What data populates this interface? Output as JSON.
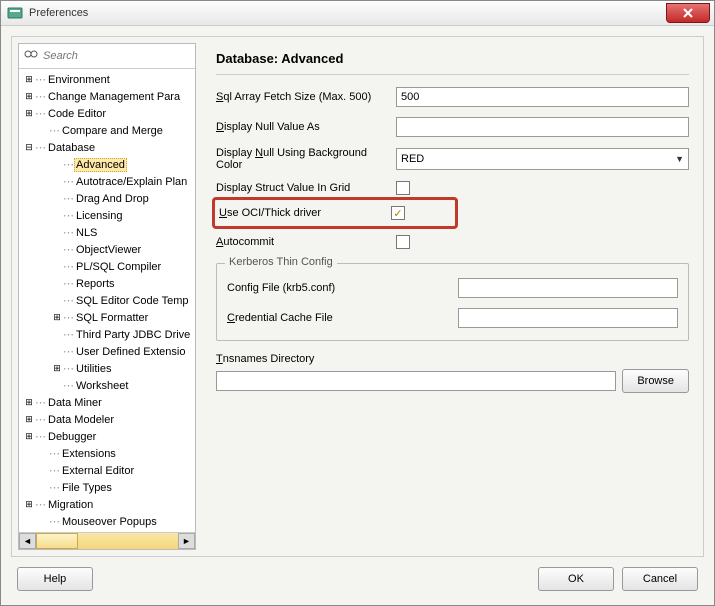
{
  "window": {
    "title": "Preferences"
  },
  "search": {
    "placeholder": "Search"
  },
  "tree": {
    "items": [
      {
        "label": "Environment",
        "expand": "plus",
        "indent": 0
      },
      {
        "label": "Change Management Para",
        "expand": "plus",
        "indent": 0
      },
      {
        "label": "Code Editor",
        "expand": "plus",
        "indent": 0
      },
      {
        "label": "Compare and Merge",
        "expand": "blank",
        "indent": 1
      },
      {
        "label": "Database",
        "expand": "minus",
        "indent": 0
      },
      {
        "label": "Advanced",
        "expand": "blank",
        "indent": 2,
        "selected": true
      },
      {
        "label": "Autotrace/Explain Plan",
        "expand": "blank",
        "indent": 2
      },
      {
        "label": "Drag And Drop",
        "expand": "blank",
        "indent": 2
      },
      {
        "label": "Licensing",
        "expand": "blank",
        "indent": 2
      },
      {
        "label": "NLS",
        "expand": "blank",
        "indent": 2
      },
      {
        "label": "ObjectViewer",
        "expand": "blank",
        "indent": 2
      },
      {
        "label": "PL/SQL Compiler",
        "expand": "blank",
        "indent": 2
      },
      {
        "label": "Reports",
        "expand": "blank",
        "indent": 2
      },
      {
        "label": "SQL Editor Code Temp",
        "expand": "blank",
        "indent": 2
      },
      {
        "label": "SQL Formatter",
        "expand": "plus",
        "indent": 2
      },
      {
        "label": "Third Party JDBC Drive",
        "expand": "blank",
        "indent": 2
      },
      {
        "label": "User Defined Extensio",
        "expand": "blank",
        "indent": 2
      },
      {
        "label": "Utilities",
        "expand": "plus",
        "indent": 2
      },
      {
        "label": "Worksheet",
        "expand": "blank",
        "indent": 2
      },
      {
        "label": "Data Miner",
        "expand": "plus",
        "indent": 0
      },
      {
        "label": "Data Modeler",
        "expand": "plus",
        "indent": 0
      },
      {
        "label": "Debugger",
        "expand": "plus",
        "indent": 0
      },
      {
        "label": "Extensions",
        "expand": "blank",
        "indent": 1
      },
      {
        "label": "External Editor",
        "expand": "blank",
        "indent": 1
      },
      {
        "label": "File Types",
        "expand": "blank",
        "indent": 1
      },
      {
        "label": "Migration",
        "expand": "plus",
        "indent": 0
      },
      {
        "label": "Mouseover Popups",
        "expand": "blank",
        "indent": 1
      }
    ]
  },
  "content": {
    "title": "Database: Advanced",
    "sqlFetchLabelPre": "S",
    "sqlFetchLabelRest": "ql Array Fetch Size (Max. 500)",
    "sqlFetchValue": "500",
    "nullValueLabelPre": "D",
    "nullValueLabelRest": "isplay Null Value As",
    "nullValue": "",
    "nullBgLabelPre": "Display ",
    "nullBgLabelU": "N",
    "nullBgLabelRest": "ull Using Background Color",
    "nullBgValue": "RED",
    "structLabel": "Display Struct Value In Grid",
    "structChecked": false,
    "ociLabelPre": "U",
    "ociLabelRest": "se OCI/Thick driver",
    "ociChecked": true,
    "autocommitLabelPre": "A",
    "autocommitLabelRest": "utocommit",
    "autocommitChecked": false,
    "kerberosLegend": "Kerberos Thin Config",
    "configFileLabelPre": "Confi",
    "configFileLabelU": "g",
    "configFileLabelRest": " File (krb5.conf)",
    "credLabelPre": "C",
    "credLabelRest": "redential Cache File",
    "tnsLabelPre": "T",
    "tnsLabelRest": "nsnames Directory",
    "browseLabelPre": "B",
    "browseLabelRest": "rowse"
  },
  "footer": {
    "helpPre": "H",
    "helpRest": "elp",
    "ok": "OK",
    "cancel": "Cancel"
  }
}
